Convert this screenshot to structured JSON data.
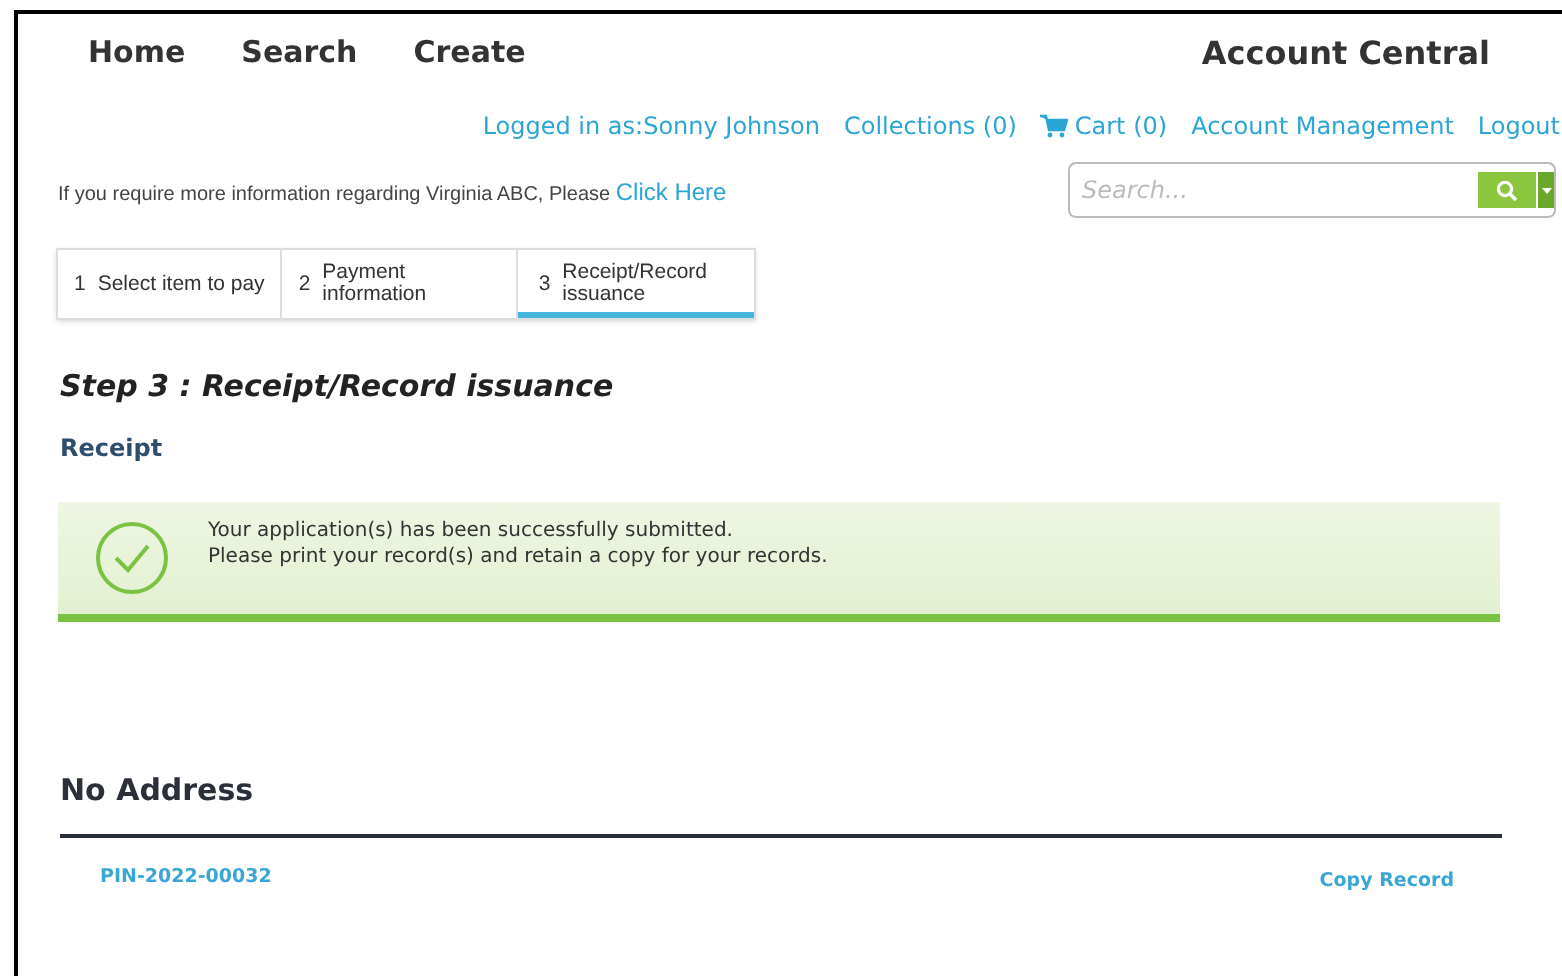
{
  "nav": [
    {
      "label": "Home"
    },
    {
      "label": "Search"
    },
    {
      "label": "Create"
    }
  ],
  "account_title": "Account Central",
  "user_links": [
    {
      "kind": "text",
      "label": "Logged in as:Sonny Johnson"
    },
    {
      "kind": "text",
      "label": "Collections (0)"
    },
    {
      "kind": "cart",
      "label": "Cart (0)"
    },
    {
      "kind": "text",
      "label": "Account Management"
    },
    {
      "kind": "text",
      "label": "Logout"
    }
  ],
  "info": {
    "text": "If you require more information regarding Virginia ABC, Please",
    "link": "Click Here"
  },
  "search": {
    "placeholder": "Search..."
  },
  "steps": [
    {
      "number": "1",
      "label": "Select item to pay",
      "selected": false
    },
    {
      "number": "2",
      "label": "Payment information",
      "selected": false
    },
    {
      "number": "3",
      "label": "Receipt/Record issuance",
      "selected": true
    }
  ],
  "heading": "Step 3 : Receipt/Record issuance",
  "section": "Receipt",
  "success": {
    "lines": [
      "Your application(s) has been successfully submitted.",
      "Please print your record(s) and retain a copy for your records."
    ]
  },
  "address_title": "No Address",
  "record": {
    "id": "PIN-2022-00032",
    "action": "Copy Record"
  }
}
